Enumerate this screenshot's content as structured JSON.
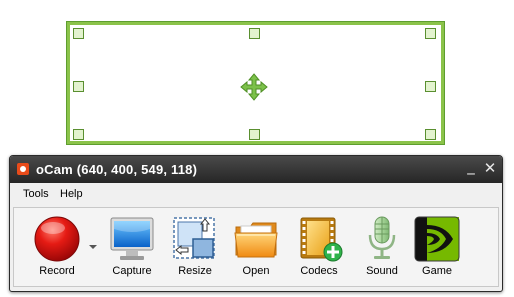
{
  "window": {
    "title": "oCam (640, 400, 549, 118)",
    "minimize_glyph": "_",
    "close_glyph": "✕"
  },
  "menu": {
    "items": [
      "Tools",
      "Help"
    ]
  },
  "toolbar": {
    "record_label": "Record",
    "capture_label": "Capture",
    "resize_label": "Resize",
    "open_label": "Open",
    "codecs_label": "Codecs",
    "sound_label": "Sound",
    "game_label": "Game"
  },
  "icons": {
    "record": "record-icon",
    "capture": "monitor-icon",
    "resize": "resize-icon",
    "open": "folder-icon",
    "codecs": "film-plus-icon",
    "sound": "microphone-icon",
    "game": "nvidia-icon",
    "move": "move-arrows-icon"
  },
  "colors": {
    "region_border": "#8bc34a",
    "title_bar": "#333333",
    "record_red": "#e01010",
    "nvidia_green": "#76b900"
  }
}
